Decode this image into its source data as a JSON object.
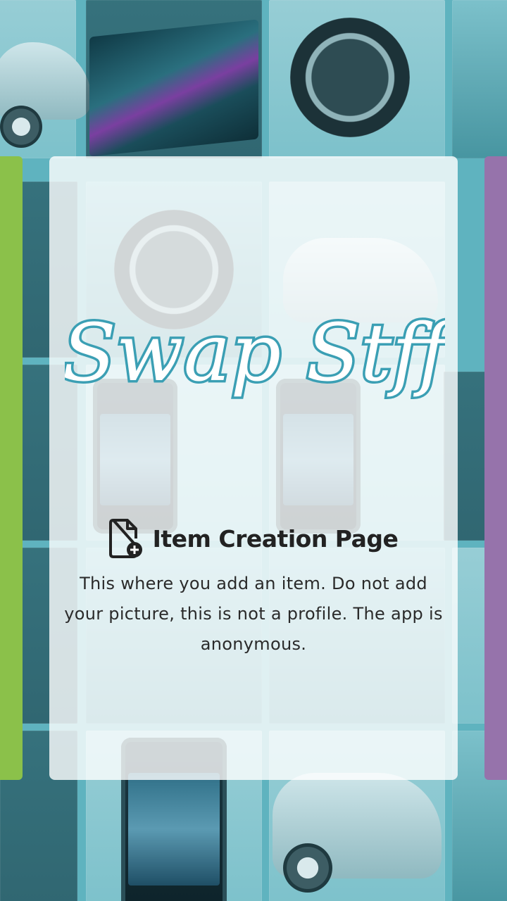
{
  "app": {
    "logo_text": "Swap Stff"
  },
  "page": {
    "title": "Item Creation Page",
    "title_icon": "file-add-icon",
    "description": "This where you add an item. Do not add your picture, this is not a profile. The app is anonymous."
  },
  "theme": {
    "background": "#5fb3bf",
    "card": "#ffffff",
    "left_panel": "#8bc14a",
    "right_panel": "#9673ab",
    "logo_fill": "#ffffff",
    "logo_stroke": "#3b9fb4"
  }
}
